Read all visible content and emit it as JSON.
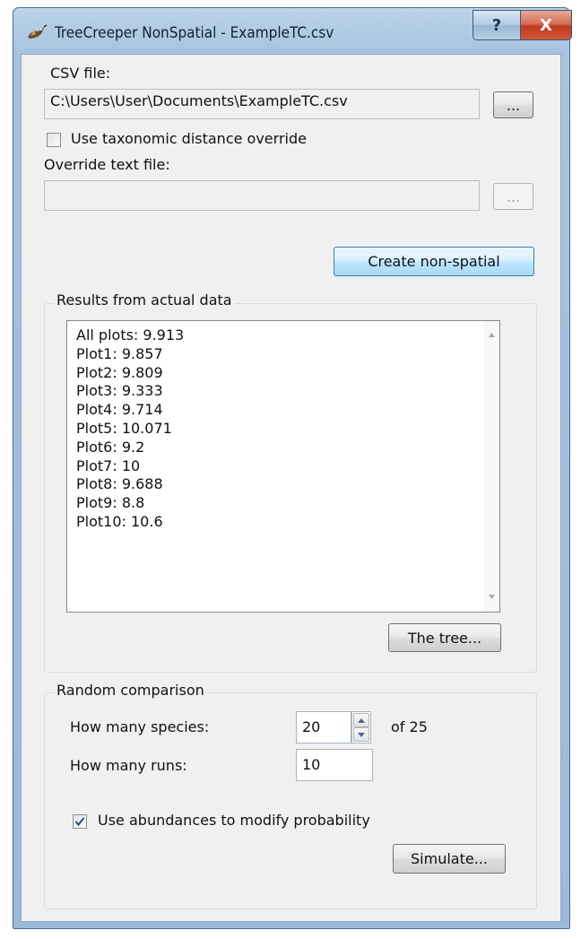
{
  "window": {
    "title": "TreeCreeper NonSpatial - ExampleTC.csv",
    "help_label": "?",
    "close_label": "X"
  },
  "csv": {
    "label": "CSV file:",
    "path": "C:\\Users\\User\\Documents\\ExampleTC.csv",
    "browse_label": "..."
  },
  "override": {
    "checkbox_label": "Use taxonomic distance override",
    "checked": false,
    "file_label": "Override text file:",
    "path": "",
    "browse_label": "..."
  },
  "create_button": "Create non-spatial",
  "results": {
    "group_title": "Results from actual data",
    "items": [
      "All plots: 9.913",
      "Plot1: 9.857",
      "Plot2: 9.809",
      "Plot3: 9.333",
      "Plot4: 9.714",
      "Plot5: 10.071",
      "Plot6: 9.2",
      "Plot7: 10",
      "Plot8: 9.688",
      "Plot9: 8.8",
      "Plot10: 10.6"
    ],
    "tree_button": "The tree..."
  },
  "random": {
    "group_title": "Random comparison",
    "species_label": "How many species:",
    "species_value": "20",
    "species_of": "of 25",
    "runs_label": "How many runs:",
    "runs_value": "10",
    "abundance_label": "Use abundances to modify probability",
    "abundance_checked": true,
    "simulate_button": "Simulate..."
  },
  "colors": {
    "window_frame": "#a6c3df",
    "close_button": "#c0391c",
    "default_button": "#bee6fd",
    "check_mark": "#2a4a8a"
  }
}
